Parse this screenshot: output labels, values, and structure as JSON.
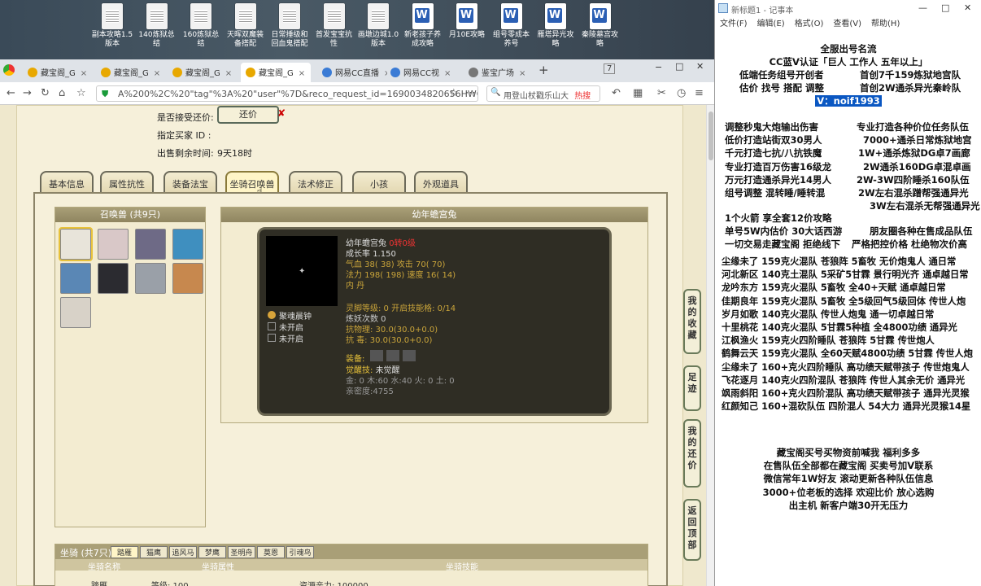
{
  "desktop": {
    "icons": [
      {
        "label": "副本攻略1.5版本",
        "type": "txt"
      },
      {
        "label": "140炼狱总结",
        "type": "txt"
      },
      {
        "label": "160炼狱总结",
        "type": "txt"
      },
      {
        "label": "天晖双魔装备搭配",
        "type": "txt"
      },
      {
        "label": "日常捶级和回血鬼搭配",
        "type": "txt"
      },
      {
        "label": "首发宝宝抗性",
        "type": "txt"
      },
      {
        "label": "画墩边城1.0版本",
        "type": "txt"
      },
      {
        "label": "新老孩子养成攻略",
        "type": "word"
      },
      {
        "label": "月10E攻略",
        "type": "word"
      },
      {
        "label": "组号零成本养号",
        "type": "word"
      },
      {
        "label": "雁塔异光攻略",
        "type": "word"
      },
      {
        "label": "秦陵墓宫攻略",
        "type": "word"
      }
    ]
  },
  "browser": {
    "tabs": [
      {
        "label": "藏宝阁_G"
      },
      {
        "label": "藏宝阁_G"
      },
      {
        "label": "藏宝阁_G"
      },
      {
        "label": "藏宝阁_G"
      },
      {
        "label": "网易CC直播"
      },
      {
        "label": "网易CC视"
      },
      {
        "label": "鉴宝广场"
      }
    ],
    "tab_close": "×",
    "new_tab": "+",
    "tab_count": "7",
    "url": "A%200%2C%20\"tag\"%3A%20\"user\"%7D&reco_request_id=1690034820656HWCov",
    "search_text": "用登山杖戳乐山大",
    "hot_label": "热搜"
  },
  "game": {
    "bargain_label": "是否接受还价:",
    "bargain_button": "还价",
    "bargain_mark": "✘",
    "buyer_label": "指定买家 ID :",
    "time_label": "出售剩余时间:",
    "time_value": "9天18时",
    "tabs": [
      "基本信息",
      "属性抗性",
      "装备法宝",
      "坐骑召唤兽",
      "法术修正",
      "小孩",
      "外观道具"
    ],
    "pets_header": "召唤兽 (共9只)",
    "pet_colors": [
      "#e8e4da",
      "#d9c8c8",
      "#6e6a86",
      "#3f8fbf",
      "#5a87b5",
      "#2b2b30",
      "#9aa0a8",
      "#c7884e",
      "#d8d2c8"
    ],
    "detail_header": "幼年蟾宫兔",
    "detail": {
      "name": "幼年蟾宫兔",
      "level": "0转0级",
      "growth_label": "成长率",
      "growth": "1.150",
      "hp": "气血 38( 38) 攻击 70( 70)",
      "mp": "法力 198( 198) 速度 16( 14)",
      "neidan": "内   丹",
      "skill": "聚魂晨钟",
      "slot1": "未开启",
      "slot2": "未开启",
      "spirit": "灵脚等级: 0 开启技能格: 0/14",
      "refine": "炼妖次数 0",
      "phys": "抗物理: 30.0(30.0+0.0)",
      "seal": "抗   毒: 30.0(30.0+0.0)",
      "equip": "装备:",
      "awaken_label": "觉醒技:",
      "awaken": "未觉醒",
      "elements": "金: 0 木:60 水:40 火: 0 土: 0",
      "intimacy": "亲密度:4755"
    },
    "mounts_header": "坐骑 (共7只)",
    "mount_tabs": [
      "踏雁",
      "猫鹰",
      "追风马",
      "梦鹰",
      "圣明舟",
      "莫恩",
      "引魂鸟"
    ],
    "mount_cols": [
      "坐骑名称",
      "坐骑属性",
      "坐骑技能"
    ],
    "mount_row": {
      "name": "踏雁",
      "level": "等级: 100",
      "exp": "资源亲力: 100000"
    },
    "side_buttons": [
      "我的收藏",
      "足迹",
      "我的还价",
      "返回顶部"
    ]
  },
  "notepad": {
    "title": "新标题1 - 记事本",
    "menu": [
      "文件(F)",
      "编辑(E)",
      "格式(O)",
      "查看(V)",
      "帮助(H)"
    ],
    "header_lines": [
      "全服出号名流",
      "CC蓝V认证「巨人 工作人 五年以上」",
      "低端任务组号开创者",
      "首创7千159炼狱地宫队",
      "估价 找号 搭配 调整",
      "首创2W通杀异光秦岭队"
    ],
    "vx": "V：noif1993",
    "ads": [
      [
        "调整秒鬼大炮输出伤害",
        "专业打造各种价位任务队伍"
      ],
      [
        "低价打造站街双30男人",
        "7000+通杀日常炼狱地宫"
      ],
      [
        "千元打造七抗/八抗铁魔",
        "1W+通杀炼狱DG卓7画廊"
      ],
      [
        "专业打造百万伤害16级龙",
        "2W通杀160DG卓混卓画"
      ],
      [
        "万元打造通杀异光14男人",
        "2W-3W四阶睡杀160队伍"
      ],
      [
        "组号调整 混转睡/睡转混",
        "2W左右混杀蹭帮强通异光"
      ],
      [
        "",
        "3W左右混杀无帮强通异光"
      ]
    ],
    "mid": [
      [
        "1个火箭 享全套12价攻略",
        ""
      ],
      [
        "单号5W内估价 30大话西游",
        "朋友圈各种在售成品队伍"
      ],
      [
        "一切交易走藏宝阁 拒绝线下",
        "严格把控价格 杜绝物次价高"
      ]
    ],
    "teams": [
      "尘缘未了 159克火混队 苍狼阵 5畜牧 无价炮鬼人 通日常",
      "河北新区 140克土混队 5采矿5甘霖 景行明光齐 通卓越日常",
      "龙吟东方 159克火混队 5畜牧 全40+天赋 通卓越日常",
      "佳期良年 159克火混队 5畜牧 全5级回气5级回体 传世人炮",
      "岁月如歌 140克火混队 传世人炮鬼 通一切卓越日常",
      "十里桃花 140克火混队 5甘霖5种植 全4800功绩 通异光",
      "江枫渔火 159克火四阶睡队 苍狼阵 5甘霖 传世炮人",
      "鹤舞云天 159克火混队 全60天赋4800功绩 5甘霖 传世人炮",
      "尘缘未了 160+克火四阶睡队 高功绩天赋带孩子 传世炮鬼人",
      "飞花逐月 140克火四阶混队 苍狼阵 传世人其余无价 通异光",
      "飒雨斜阳 160+克火四阶混队 高功绩天赋带孩子 通异光灵猴",
      "红颜知己 160+混砍队伍 四阶混人 54大力 通异光灵猴14星"
    ],
    "footer": [
      "藏宝阁买号买物资前喊我 福利多多",
      "在售队伍全部都在藏宝阁 买卖号加V联系",
      "微信常年1W好友 滚动更新各种队伍信息",
      "3000+位老板的选择 欢迎比价 放心选购",
      "出主机 新客户端30开无压力"
    ]
  }
}
